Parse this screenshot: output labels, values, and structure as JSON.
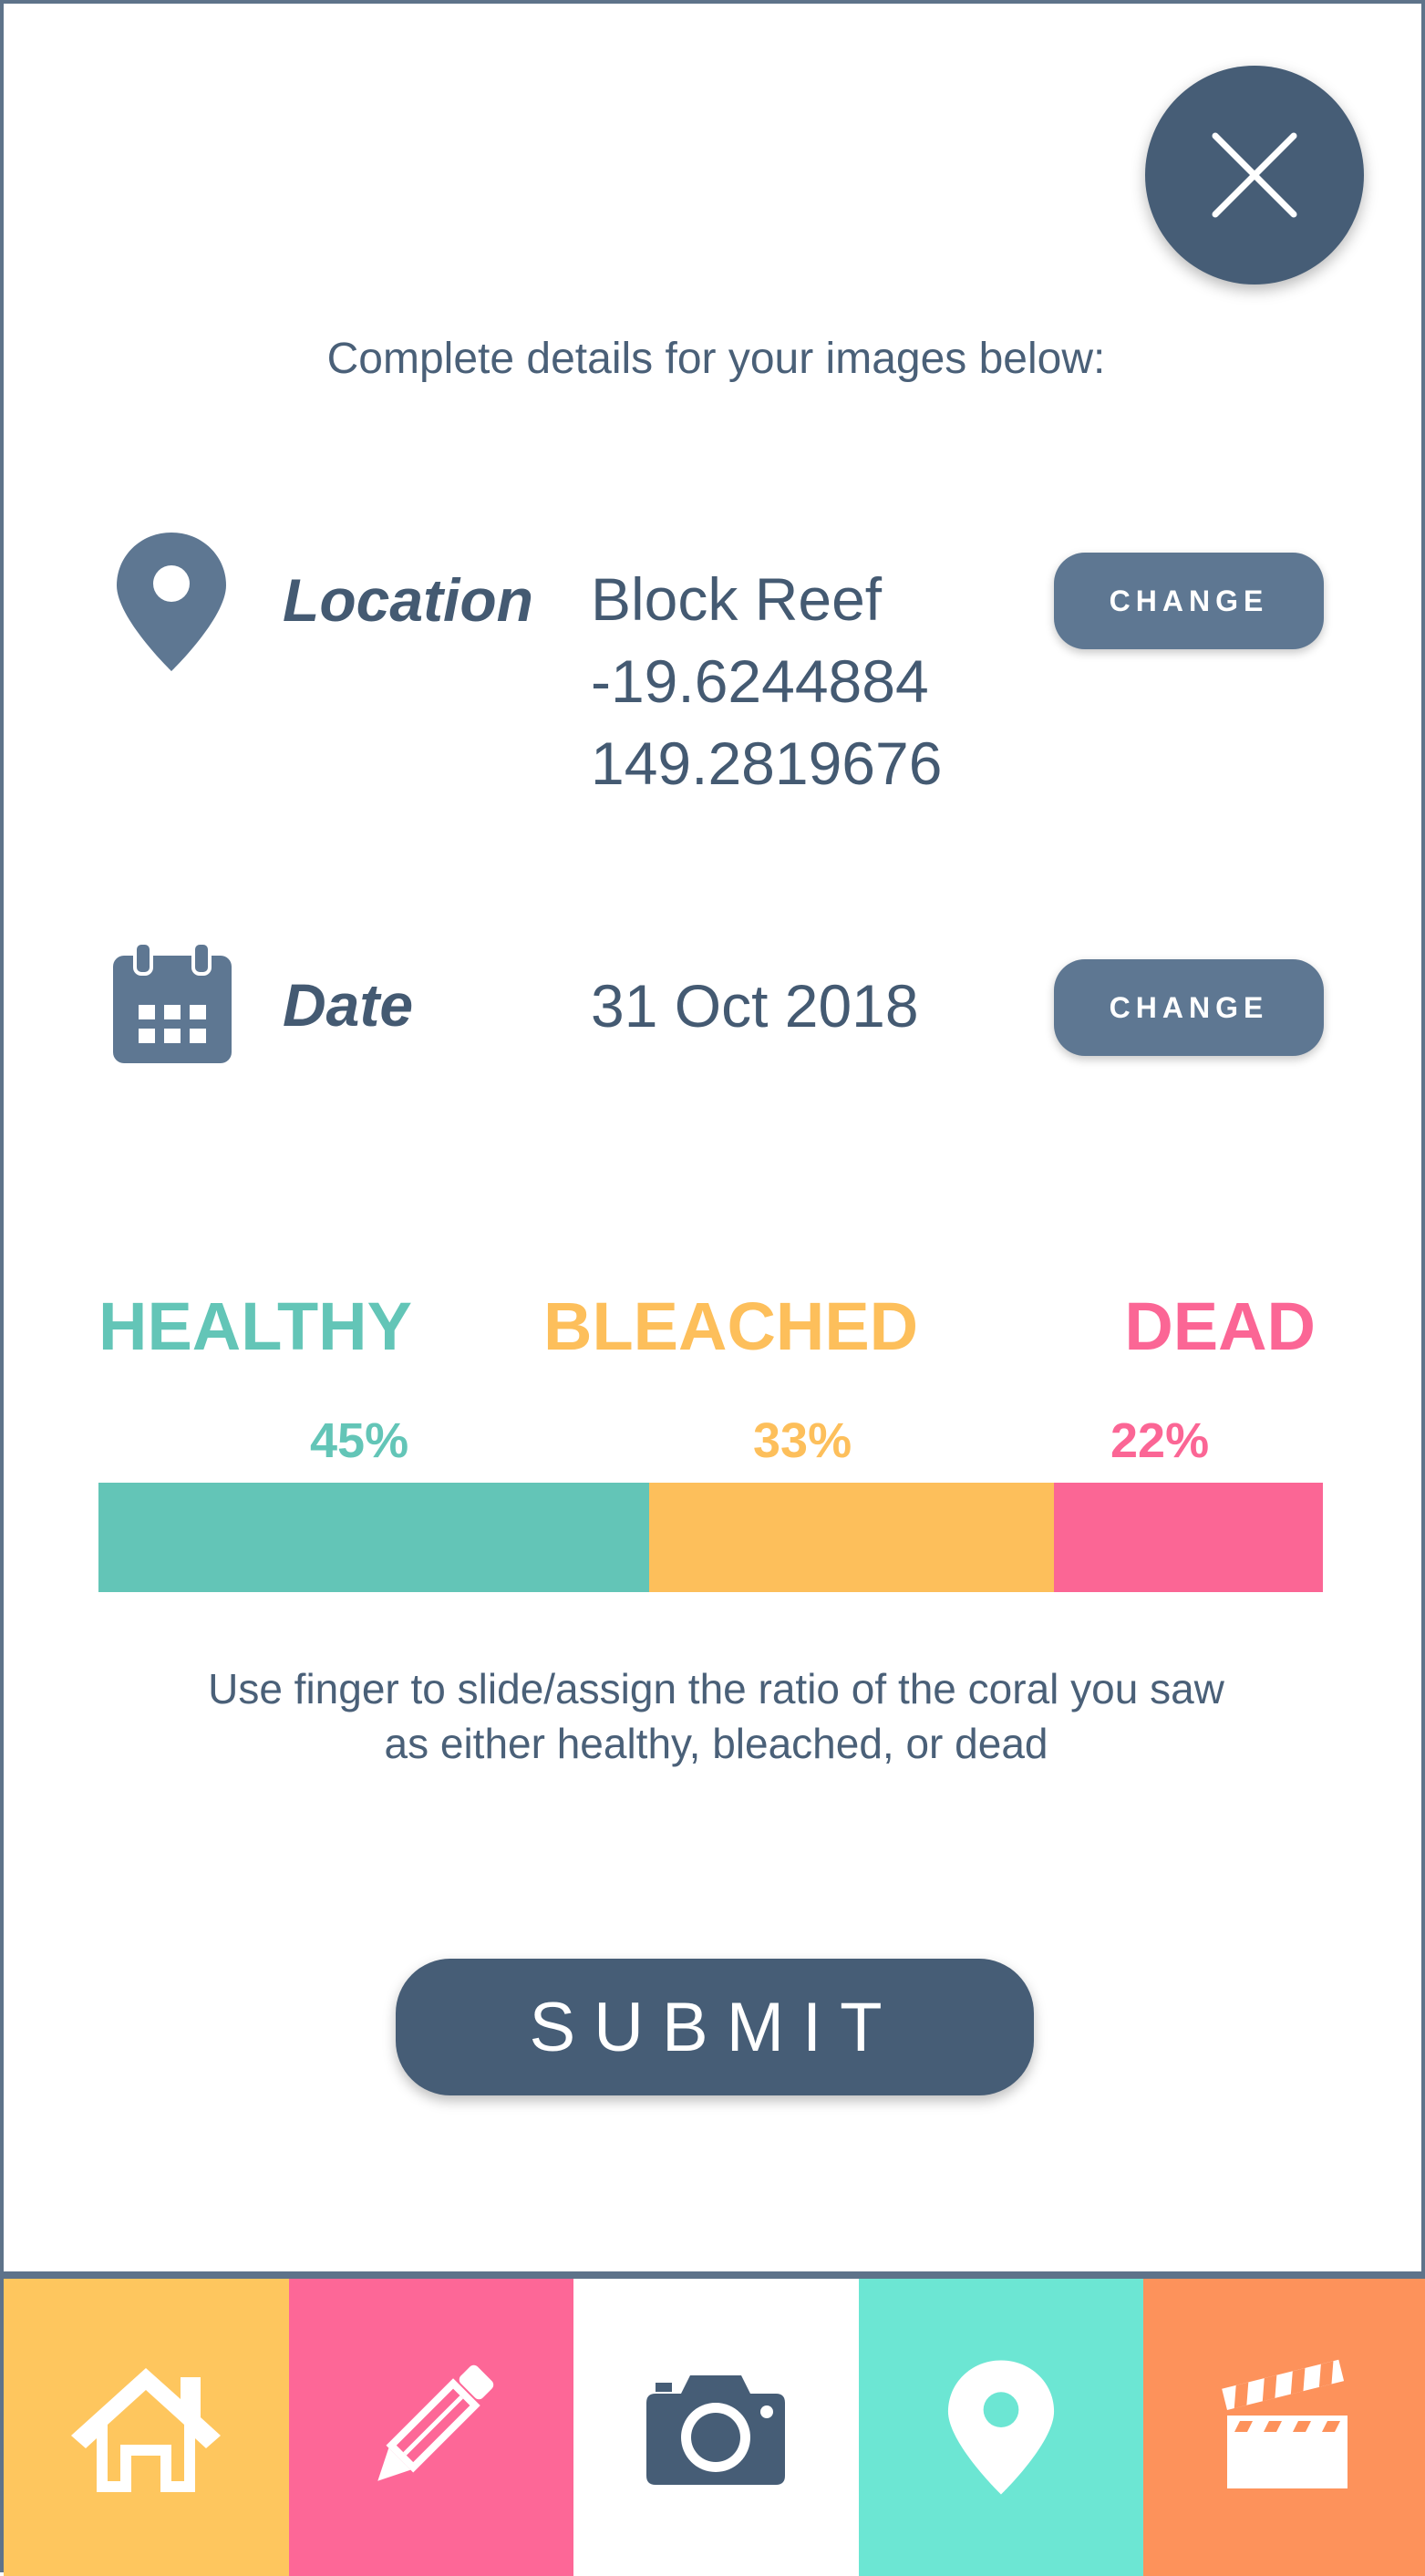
{
  "header": {
    "close_label": "X",
    "intro": "Complete details for your images below:"
  },
  "location": {
    "label": "Location",
    "name": "Block Reef",
    "lat": "-19.6244884",
    "lon": "149.2819676",
    "change_label": "CHANGE",
    "icon": "map-pin-icon"
  },
  "date": {
    "label": "Date",
    "value": "31 Oct 2018",
    "change_label": "CHANGE",
    "icon": "calendar-icon"
  },
  "ratio": {
    "categories": [
      "HEALTHY",
      "BLEACHED",
      "DEAD"
    ],
    "percent_labels": [
      "45%",
      "33%",
      "22%"
    ],
    "values": [
      45,
      33,
      22
    ],
    "colors": [
      "#63c5b7",
      "#fdbf5b",
      "#fb6695"
    ],
    "hint_line1": "Use finger to slide/assign the ratio of the coral you saw",
    "hint_line2": "as either healthy, bleached, or dead"
  },
  "submit_label": "SUBMIT",
  "nav": {
    "items": [
      {
        "icon": "home-icon",
        "color": "#fec65e"
      },
      {
        "icon": "pencil-icon",
        "color": "#fd6797"
      },
      {
        "icon": "camera-icon",
        "color": "#ffffff"
      },
      {
        "icon": "map-pin-icon",
        "color": "#6ce6d3"
      },
      {
        "icon": "clapperboard-icon",
        "color": "#fd925b"
      }
    ]
  },
  "colors": {
    "primary": "#465d76",
    "button": "#5e7792",
    "healthy": "#63c5b7",
    "bleached": "#fdbf5b",
    "dead": "#fb6695"
  }
}
